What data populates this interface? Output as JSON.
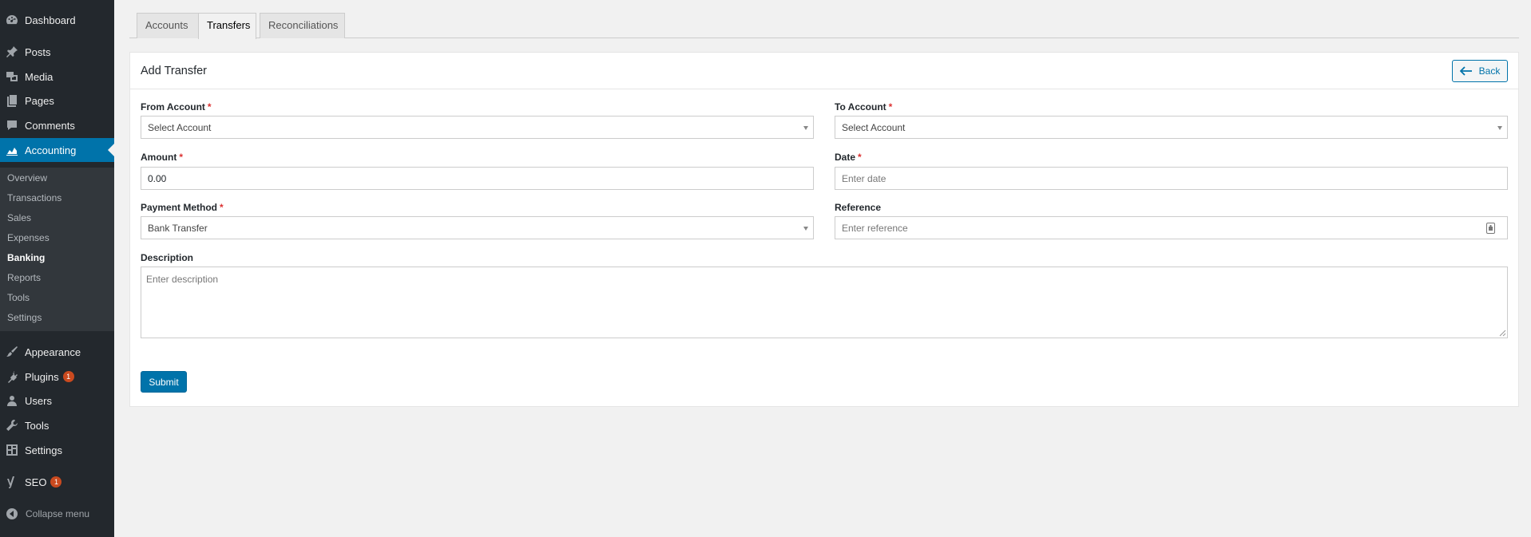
{
  "sidebar": {
    "menu": [
      {
        "label": "Dashboard",
        "icon": "dashboard-icon"
      },
      {
        "label": "Posts",
        "icon": "pin-icon"
      },
      {
        "label": "Media",
        "icon": "media-icon"
      },
      {
        "label": "Pages",
        "icon": "pages-icon"
      },
      {
        "label": "Comments",
        "icon": "comments-icon"
      },
      {
        "label": "Accounting",
        "icon": "chart-area-icon"
      }
    ],
    "submenu": [
      "Overview",
      "Transactions",
      "Sales",
      "Expenses",
      "Banking",
      "Reports",
      "Tools",
      "Settings"
    ],
    "current_submenu": "Banking",
    "menu2": [
      {
        "label": "Appearance",
        "icon": "brush-icon"
      },
      {
        "label": "Plugins",
        "icon": "plugin-icon",
        "badge": "1"
      },
      {
        "label": "Users",
        "icon": "users-icon"
      },
      {
        "label": "Tools",
        "icon": "wrench-icon"
      },
      {
        "label": "Settings",
        "icon": "settings-icon"
      },
      {
        "label": "SEO",
        "icon": "yoast-icon",
        "badge": "1"
      }
    ],
    "collapse_label": "Collapse menu"
  },
  "tabs": [
    "Accounts",
    "Transfers",
    "Reconciliations"
  ],
  "active_tab": "Transfers",
  "panel": {
    "title": "Add Transfer",
    "back_label": "Back"
  },
  "form": {
    "from_account": {
      "label": "From Account",
      "required": "*",
      "placeholder": "Select Account"
    },
    "to_account": {
      "label": "To Account",
      "required": "*",
      "placeholder": "Select Account"
    },
    "amount": {
      "label": "Amount",
      "required": "*",
      "value": "0.00"
    },
    "date": {
      "label": "Date",
      "required": "*",
      "placeholder": "Enter date"
    },
    "payment_method": {
      "label": "Payment Method",
      "required": "*",
      "value": "Bank Transfer"
    },
    "reference": {
      "label": "Reference",
      "placeholder": "Enter reference"
    },
    "description": {
      "label": "Description",
      "placeholder": "Enter description"
    },
    "submit_label": "Submit"
  },
  "colors": {
    "sidebar_bg": "#23282d",
    "submenu_bg": "#32373c",
    "accent": "#0073aa",
    "badge": "#ca4a1f",
    "required": "#dc3232"
  }
}
